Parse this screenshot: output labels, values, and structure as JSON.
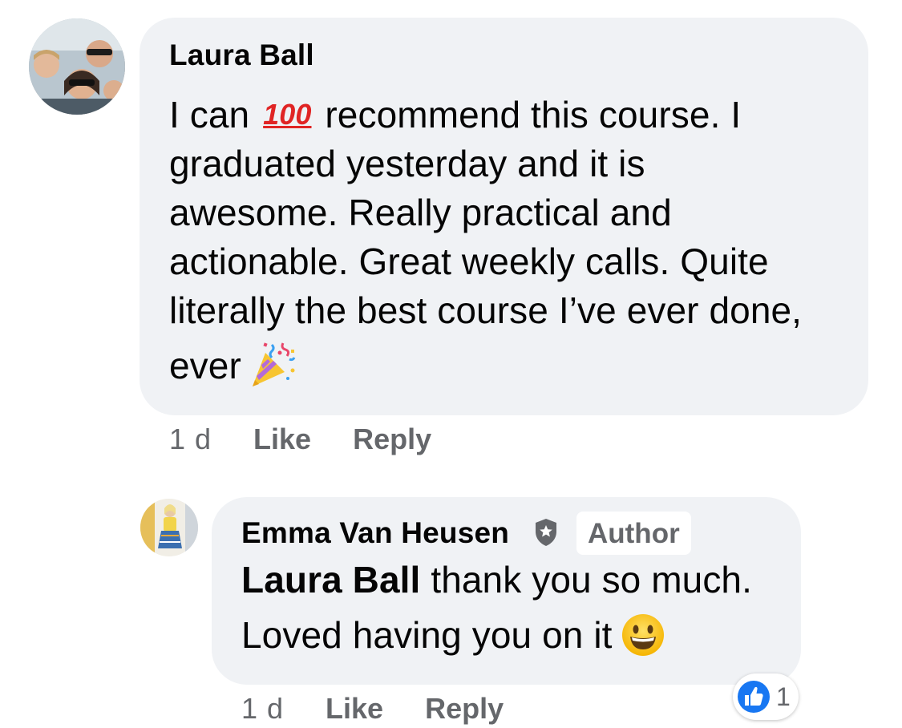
{
  "comments": [
    {
      "author": "Laura Ball",
      "text": {
        "l1_before": "I can",
        "l1_emoji": "100",
        "l1_after": "recommend this course. I",
        "l2": "graduated yesterday and it is",
        "l3": "awesome. Really practical and",
        "l4": "actionable. Great weekly calls. Quite",
        "l5": "literally the best course I’ve ever done,",
        "l6": "ever"
      },
      "emojis": [
        "hundred-points-emoji",
        "party-popper-emoji"
      ],
      "timestamp": "1 d",
      "like_label": "Like",
      "reply_label": "Reply"
    },
    {
      "author": "Emma Van Heusen",
      "badge": "Author",
      "mention": "Laura Ball",
      "text": {
        "l1_rest": "thank you so much.",
        "l2": "Loved having you on it"
      },
      "emojis": [
        "grinning-face-emoji"
      ],
      "timestamp": "1 d",
      "like_label": "Like",
      "reply_label": "Reply",
      "reaction": {
        "icon": "thumbs-up-icon",
        "count": "1",
        "color": "#1877f2"
      }
    }
  ],
  "colors": {
    "bubble": "#f0f2f5",
    "secondary_text": "#65676b",
    "primary_text": "#050505",
    "like_blue": "#1877f2"
  }
}
